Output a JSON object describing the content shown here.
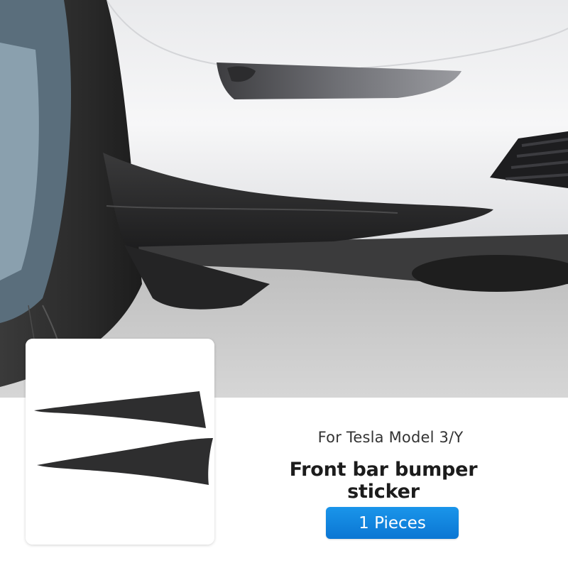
{
  "product": {
    "compatibility_text": "For Tesla Model 3/Y",
    "name": "Front bar bumper sticker",
    "quantity_label": "1 Pieces"
  },
  "colors": {
    "badge": "#1288e3",
    "car_body": "#f2f3f4",
    "spoiler": "#2b2b2b"
  }
}
